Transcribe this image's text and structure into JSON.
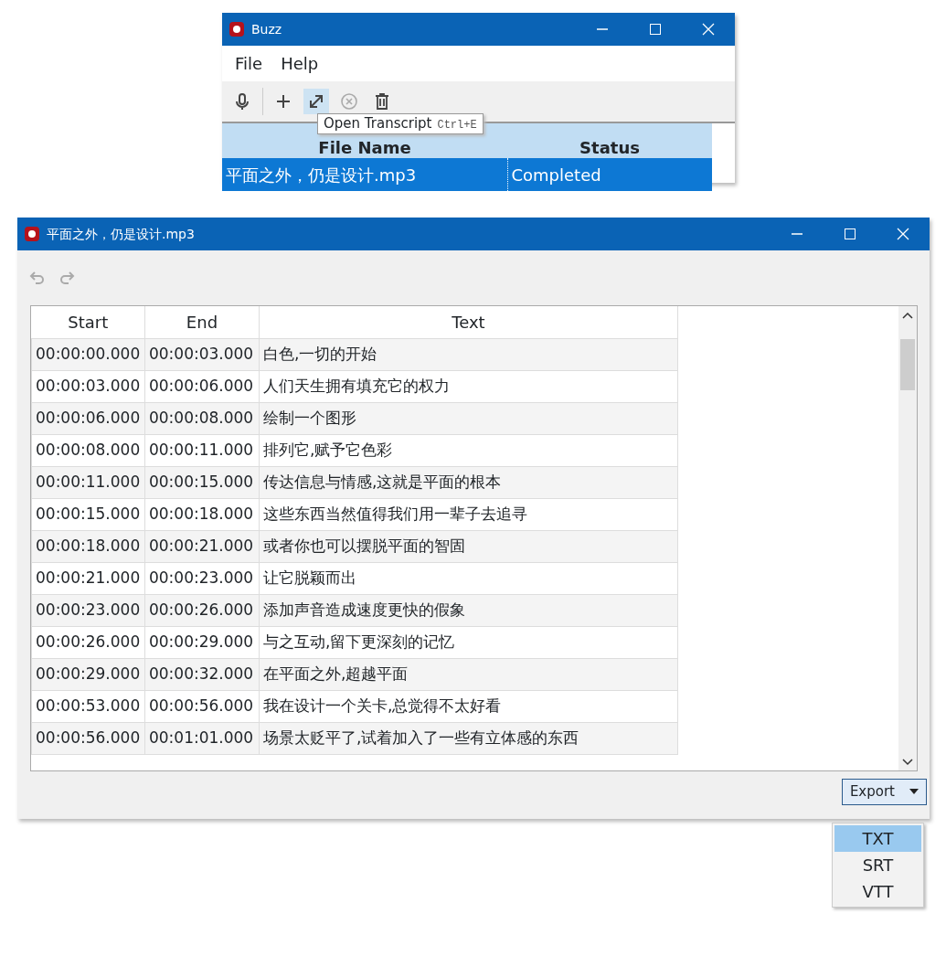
{
  "main_window": {
    "title": "Buzz",
    "menu": [
      "File",
      "Help"
    ],
    "toolbar": [
      {
        "kind": "record",
        "disabled": false,
        "hovered": false
      },
      {
        "kind": "add",
        "disabled": false,
        "hovered": false
      },
      {
        "kind": "open",
        "disabled": false,
        "hovered": true
      },
      {
        "kind": "cancel",
        "disabled": true,
        "hovered": false
      },
      {
        "kind": "delete",
        "disabled": false,
        "hovered": false
      }
    ],
    "tooltip": {
      "text": "Open Transcript",
      "shortcut": "Ctrl+E"
    },
    "table": {
      "columns": [
        "File Name",
        "Status"
      ],
      "rows": [
        {
          "cells": [
            "平面之外，仍是设计.mp3",
            "Completed"
          ],
          "selected": true
        }
      ]
    }
  },
  "transcript_window": {
    "title": "平面之外，仍是设计.mp3",
    "toolbar": [
      {
        "kind": "undo",
        "disabled": true
      },
      {
        "kind": "redo",
        "disabled": true
      }
    ],
    "table": {
      "columns": [
        "Start",
        "End",
        "Text"
      ],
      "rows": [
        [
          "00:00:00.000",
          "00:00:03.000",
          "白色,一切的开始"
        ],
        [
          "00:00:03.000",
          "00:00:06.000",
          "人们天生拥有填充它的权力"
        ],
        [
          "00:00:06.000",
          "00:00:08.000",
          "绘制一个图形"
        ],
        [
          "00:00:08.000",
          "00:00:11.000",
          "排列它,赋予它色彩"
        ],
        [
          "00:00:11.000",
          "00:00:15.000",
          "传达信息与情感,这就是平面的根本"
        ],
        [
          "00:00:15.000",
          "00:00:18.000",
          "这些东西当然值得我们用一辈子去追寻"
        ],
        [
          "00:00:18.000",
          "00:00:21.000",
          "或者你也可以摆脱平面的智固"
        ],
        [
          "00:00:21.000",
          "00:00:23.000",
          "让它脱颖而出"
        ],
        [
          "00:00:23.000",
          "00:00:26.000",
          "添加声音造成速度更快的假象"
        ],
        [
          "00:00:26.000",
          "00:00:29.000",
          "与之互动,留下更深刻的记忆"
        ],
        [
          "00:00:29.000",
          "00:00:32.000",
          "在平面之外,超越平面"
        ],
        [
          "00:00:53.000",
          "00:00:56.000",
          "我在设计一个关卡,总觉得不太好看"
        ],
        [
          "00:00:56.000",
          "00:01:01.000",
          "场景太贬平了,试着加入了一些有立体感的东西"
        ]
      ]
    },
    "export": {
      "label": "Export",
      "options": [
        {
          "label": "TXT",
          "selected": true
        },
        {
          "label": "SRT",
          "selected": false
        },
        {
          "label": "VTT",
          "selected": false
        }
      ]
    }
  }
}
